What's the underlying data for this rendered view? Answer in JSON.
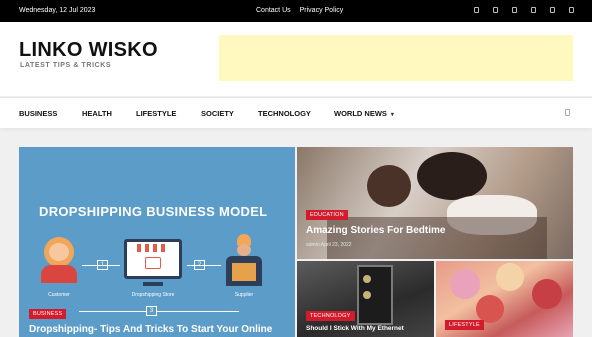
{
  "topbar": {
    "date": "Wednesday, 12 Jul 2023",
    "links": [
      "Contact Us",
      "Privacy Policy"
    ],
    "social_icons": [
      "facebook-icon",
      "twitter-icon",
      "instagram-icon",
      "youtube-icon",
      "linkedin-icon",
      "pinterest-icon"
    ]
  },
  "header": {
    "site_title": "LINKO WISKO",
    "tagline": "LATEST TIPS & TRICKS",
    "ad_color": "#fff9c0"
  },
  "nav": {
    "items": [
      "BUSINESS",
      "HEALTH",
      "LIFESTYLE",
      "SOCIETY",
      "TECHNOLOGY",
      "WORLD NEWS"
    ],
    "search_icon": "search-icon"
  },
  "posts": [
    {
      "category": "BUSINESS",
      "image_headline": "DROPSHIPPING BUSINESS MODEL",
      "diagram_labels": [
        "Customer",
        "Dropshipping Store",
        "Supplier"
      ],
      "steps": [
        "1",
        "2",
        "3"
      ],
      "title": "Dropshipping- Tips And Tricks To Start Your Online"
    },
    {
      "category": "EDUCATION",
      "title": "Amazing Stories For Bedtime",
      "meta": "admin April 23, 2022"
    },
    {
      "category": "TECHNOLOGY",
      "title": "Should I Stick With My Ethernet"
    },
    {
      "category": "LIFESTYLE",
      "title": ""
    }
  ],
  "colors": {
    "accent": "#d31b2c",
    "topbar": "#000000",
    "ad": "#fff9c0"
  }
}
